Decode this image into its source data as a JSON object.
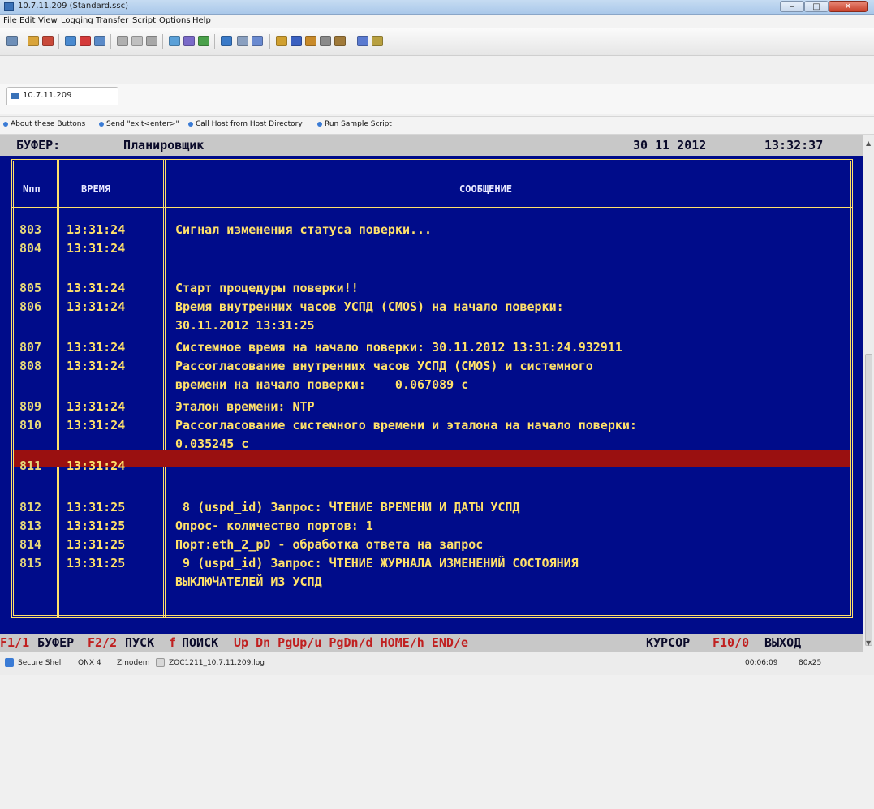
{
  "window": {
    "title": "10.7.11.209 (Standard.ssc)"
  },
  "menu": {
    "items": [
      "File",
      "Edit",
      "View",
      "Logging",
      "Transfer",
      "Script",
      "Options",
      "Help"
    ]
  },
  "tab": {
    "label": "10.7.11.209"
  },
  "button_bar": {
    "items": [
      "About these Buttons",
      "Send \"exit<enter>\"",
      "Call Host from Host Directory",
      "Run Sample Script"
    ]
  },
  "terminal": {
    "header": {
      "label": "БУФЕР:",
      "value": "Планировщик",
      "date": "30 11 2012",
      "time": "13:32:37"
    },
    "columns": {
      "num": "Nпп",
      "time": "ВРЕМЯ",
      "message": "СООБЩЕНИЕ"
    },
    "rows": [
      {
        "num": "803",
        "time": "13:31:24",
        "message": "Сигнал изменения статуса поверки..."
      },
      {
        "num": "804",
        "time": "13:31:24",
        "message": ""
      },
      {
        "num": "805",
        "time": "13:31:24",
        "message": "Старт процедуры поверки!!"
      },
      {
        "num": "806",
        "time": "13:31:24",
        "message": "Время внутренних часов УСПД (CMOS) на начало поверки:"
      },
      {
        "num": "",
        "time": "",
        "message": "30.11.2012 13:31:25"
      },
      {
        "num": "807",
        "time": "13:31:24",
        "message": "Системное время на начало поверки: 30.11.2012 13:31:24.932911"
      },
      {
        "num": "808",
        "time": "13:31:24",
        "message": "Рассогласование внутренних часов УСПД (CMOS) и системного"
      },
      {
        "num": "",
        "time": "",
        "message": "времени на начало поверки:    0.067089 с"
      },
      {
        "num": "809",
        "time": "13:31:24",
        "message": "Эталон времени: NTP"
      },
      {
        "num": "810",
        "time": "13:31:24",
        "message": "Рассогласование системного времени и эталона на начало поверки:"
      },
      {
        "num": "",
        "time": "",
        "message": "0.035245 с"
      },
      {
        "num": "811",
        "time": "13:31:24",
        "message": ""
      },
      {
        "num": "812",
        "time": "13:31:25",
        "message": " 8 (uspd_id) Запрос: ЧТЕНИЕ ВРЕМЕНИ И ДАТЫ УСПД"
      },
      {
        "num": "813",
        "time": "13:31:25",
        "message": "Опрос- количество портов: 1"
      },
      {
        "num": "814",
        "time": "13:31:25",
        "message": "Порт:eth_2_pD - обработка ответа на запрос"
      },
      {
        "num": "815",
        "time": "13:31:25",
        "message": " 9 (uspd_id) Запрос: ЧТЕНИЕ ЖУРНАЛА ИЗМЕНЕНИЙ СОСТОЯНИЯ"
      },
      {
        "num": "",
        "time": "",
        "message": "ВЫКЛЮЧАТЕЛЕЙ ИЗ УСПД"
      }
    ],
    "function_keys": [
      {
        "key": "F1/1",
        "label": "БУФЕР"
      },
      {
        "key": "F2/2",
        "label": "ПУСК"
      },
      {
        "key": "f",
        "label": "ПОИСК"
      },
      {
        "key": "Up Dn PgUp/u PgDn/d HOME/h END/e",
        "label": "КУРСОР"
      },
      {
        "key": "F10/0",
        "label": "ВЫХОД"
      }
    ]
  },
  "status_bar": {
    "protocol": "Secure Shell",
    "os": "QNX 4",
    "transfer": "Zmodem",
    "logfile": "ZOC1211_10.7.11.209.log",
    "elapsed": "00:06:09",
    "size": "80x25"
  },
  "colors": {
    "terminal_bg": "#000c8a",
    "text_yellow": "#ffe16a",
    "highlight_red": "#9a1010",
    "fkey_red": "#c02020"
  },
  "icons": [
    "app-icon",
    "minimize-icon",
    "maximize-icon",
    "close-icon",
    "tab-host-icon",
    "button-dot-icon",
    "secure-shell-icon",
    "logfile-icon"
  ]
}
